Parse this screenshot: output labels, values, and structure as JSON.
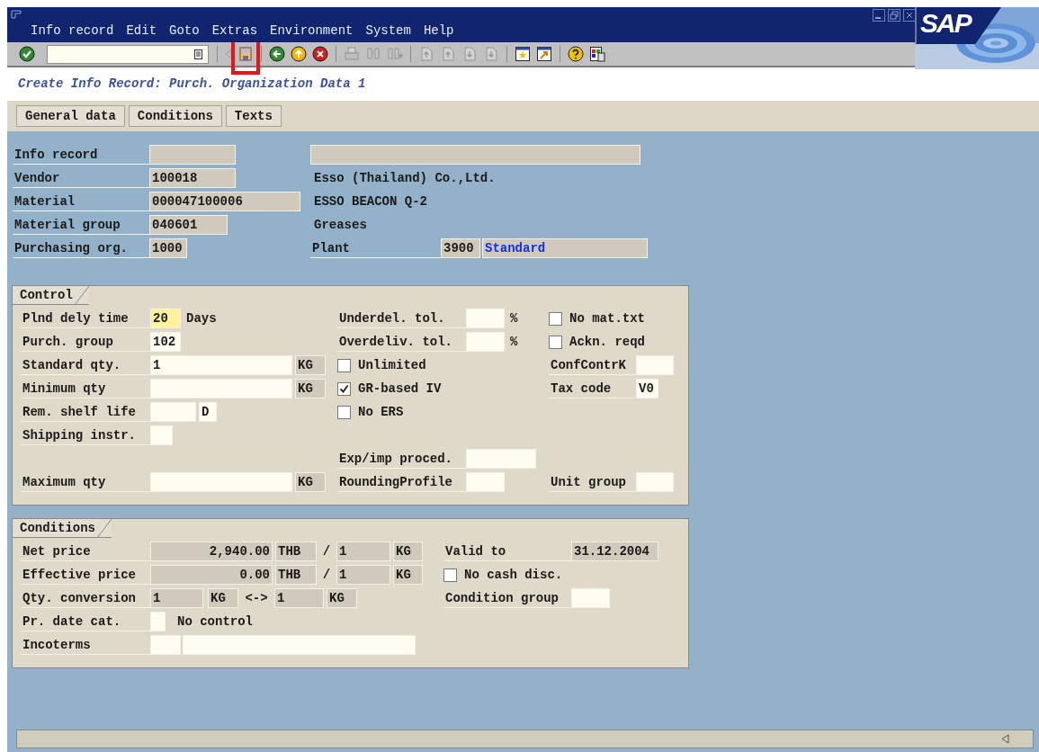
{
  "menu": [
    "Info record",
    "Edit",
    "Goto",
    "Extras",
    "Environment",
    "System",
    "Help"
  ],
  "toolbar": [
    [
      {
        "kind": "enter",
        "disabled": false,
        "highlighted": false
      }
    ],
    [
      {
        "kind": "history",
        "disabled": true,
        "highlighted": false
      },
      {
        "kind": "save",
        "disabled": false,
        "highlighted": true
      }
    ],
    [
      {
        "kind": "back",
        "disabled": false,
        "highlighted": false
      },
      {
        "kind": "exit",
        "disabled": false,
        "highlighted": false
      },
      {
        "kind": "cancel",
        "disabled": false,
        "highlighted": false
      }
    ],
    [
      {
        "kind": "print",
        "disabled": true,
        "highlighted": false
      },
      {
        "kind": "find",
        "disabled": true,
        "highlighted": false
      },
      {
        "kind": "find_next",
        "disabled": true,
        "highlighted": false
      }
    ],
    [
      {
        "kind": "first_page",
        "disabled": true,
        "highlighted": false
      },
      {
        "kind": "prev_page",
        "disabled": true,
        "highlighted": false
      },
      {
        "kind": "next_page",
        "disabled": true,
        "highlighted": false
      },
      {
        "kind": "last_page",
        "disabled": true,
        "highlighted": false
      }
    ],
    [
      {
        "kind": "create_session",
        "disabled": false,
        "highlighted": false
      },
      {
        "kind": "shortcut",
        "disabled": false,
        "highlighted": false
      }
    ],
    [
      {
        "kind": "help",
        "disabled": false,
        "highlighted": false
      },
      {
        "kind": "layout",
        "disabled": false,
        "highlighted": false
      }
    ]
  ],
  "logo": "SAP",
  "title": "Create Info Record: Purch. Organization Data 1",
  "buttons": [
    "General data",
    "Conditions",
    "Texts"
  ],
  "header": {
    "info_record": {
      "label": "Info record",
      "field": {
        "editable": false
      },
      "text_field": {
        "editable": false
      }
    },
    "vendor": {
      "label": "Vendor",
      "field": {
        "value": "100018",
        "editable": false
      },
      "description": "Esso (Thailand) Co.,Ltd."
    },
    "material": {
      "label": "Material",
      "field": {
        "value": "000047100006",
        "editable": false
      },
      "description": "ESSO BEACON Q-2"
    },
    "material_group": {
      "label": "Material group",
      "field": {
        "value": "040601",
        "editable": false
      },
      "description": "Greases"
    },
    "purchasing_org": {
      "label": "Purchasing org.",
      "field": {
        "value": "1000",
        "editable": false
      }
    },
    "plant": {
      "label": "Plant",
      "field": {
        "value": "3900",
        "editable": false
      },
      "description_field": {
        "value": "Standard",
        "editable": false
      }
    }
  },
  "control": {
    "title": "Control",
    "plnd_dely_time": {
      "label": "Plnd dely time",
      "field": {
        "value": "20",
        "focused": true
      },
      "unit": "Days"
    },
    "purch_group": {
      "label": "Purch. group",
      "field": {
        "value": "102",
        "editable": true
      }
    },
    "standard_qty": {
      "label": "Standard qty.",
      "field": {
        "value": "1",
        "editable": true
      },
      "unit": {
        "value": "KG",
        "editable": false
      }
    },
    "minimum_qty": {
      "label": "Minimum qty",
      "field": {
        "editable": true
      },
      "unit": {
        "value": "KG",
        "editable": false
      }
    },
    "rem_shelf_life": {
      "label": "Rem. shelf life",
      "field": {
        "editable": true
      },
      "unit": {
        "value": "D",
        "editable": true
      }
    },
    "shipping_instr": {
      "label": "Shipping instr.",
      "field": {
        "editable": true
      }
    },
    "maximum_qty": {
      "label": "Maximum qty",
      "field": {
        "editable": true
      },
      "unit": {
        "value": "KG",
        "editable": false
      }
    },
    "underdel_tol": {
      "label": "Underdel. tol.",
      "field": {
        "editable": true
      },
      "unit": "%"
    },
    "overdeliv_tol": {
      "label": "Overdeliv. tol.",
      "field": {
        "editable": true
      },
      "unit": "%"
    },
    "unlimited": {
      "label": "Unlimited",
      "checked": false
    },
    "gr_based_iv": {
      "label": "GR-based IV",
      "checked": true
    },
    "no_ers": {
      "label": "No ERS",
      "checked": false
    },
    "exp_imp_proced": {
      "label": "Exp/imp proced.",
      "field": {
        "editable": true
      }
    },
    "rounding_profile": {
      "label": "RoundingProfile",
      "field": {
        "editable": true
      }
    },
    "no_mat_txt": {
      "label": "No mat.txt",
      "checked": false
    },
    "ackn_reqd": {
      "label": "Ackn. reqd",
      "checked": false
    },
    "conf_contr_k": {
      "label": "ConfContrK",
      "field": {
        "editable": true
      }
    },
    "tax_code": {
      "label": "Tax code",
      "field": {
        "value": "V0",
        "editable": true
      }
    },
    "unit_group": {
      "label": "Unit group",
      "field": {
        "editable": true
      }
    }
  },
  "conditions": {
    "title": "Conditions",
    "net_price": {
      "label": "Net price",
      "amount": {
        "value": "2,940.00",
        "editable": false
      },
      "currency": {
        "value": "THB",
        "editable": false
      },
      "per_sign": "/",
      "quantity": {
        "value": "1",
        "editable": false
      },
      "unit": {
        "value": "KG",
        "editable": false
      }
    },
    "effective_price": {
      "label": "Effective price",
      "amount": {
        "value": "0.00",
        "editable": false
      },
      "currency": {
        "value": "THB",
        "editable": false
      },
      "per_sign": "/",
      "quantity": {
        "value": "1",
        "editable": false
      },
      "unit": {
        "value": "KG",
        "editable": false
      }
    },
    "qty_conversion": {
      "label": "Qty. conversion",
      "quantity": {
        "value": "1",
        "editable": false
      },
      "unit": {
        "value": "KG",
        "editable": false
      },
      "arrow": "<->",
      "quantity_2": {
        "value": "1",
        "editable": false
      },
      "unit_2": {
        "value": "KG",
        "editable": false
      }
    },
    "pr_date_cat": {
      "label": "Pr. date cat.",
      "field": {
        "editable": true
      },
      "description": "No control"
    },
    "incoterms": {
      "label": "Incoterms",
      "field": {
        "editable": true
      },
      "field_2": {
        "editable": true
      }
    },
    "valid_to": {
      "label": "Valid to",
      "field": {
        "value": "31.12.2004",
        "editable": false
      }
    },
    "no_cash_disc": {
      "label": "No cash disc.",
      "checked": false
    },
    "condition_group": {
      "label": "Condition group",
      "field": {
        "editable": true
      }
    }
  }
}
